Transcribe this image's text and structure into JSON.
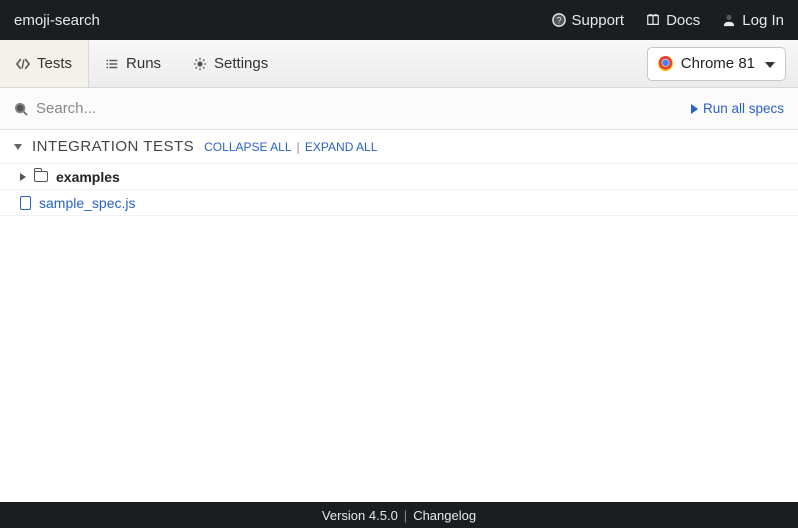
{
  "header": {
    "project_name": "emoji-search",
    "links": {
      "support": "Support",
      "docs": "Docs",
      "login": "Log In"
    }
  },
  "tabs": {
    "tests": "Tests",
    "runs": "Runs",
    "settings": "Settings",
    "active": "tests"
  },
  "browser": {
    "label": "Chrome 81"
  },
  "search": {
    "placeholder": "Search..."
  },
  "run_all": {
    "label": "Run all specs"
  },
  "section": {
    "title": "INTEGRATION TESTS",
    "collapse_all": "COLLAPSE ALL",
    "expand_all": "EXPAND ALL"
  },
  "tree": {
    "folder_examples": "examples",
    "file_sample": "sample_spec.js"
  },
  "footer": {
    "version": "Version 4.5.0",
    "changelog": "Changelog"
  }
}
